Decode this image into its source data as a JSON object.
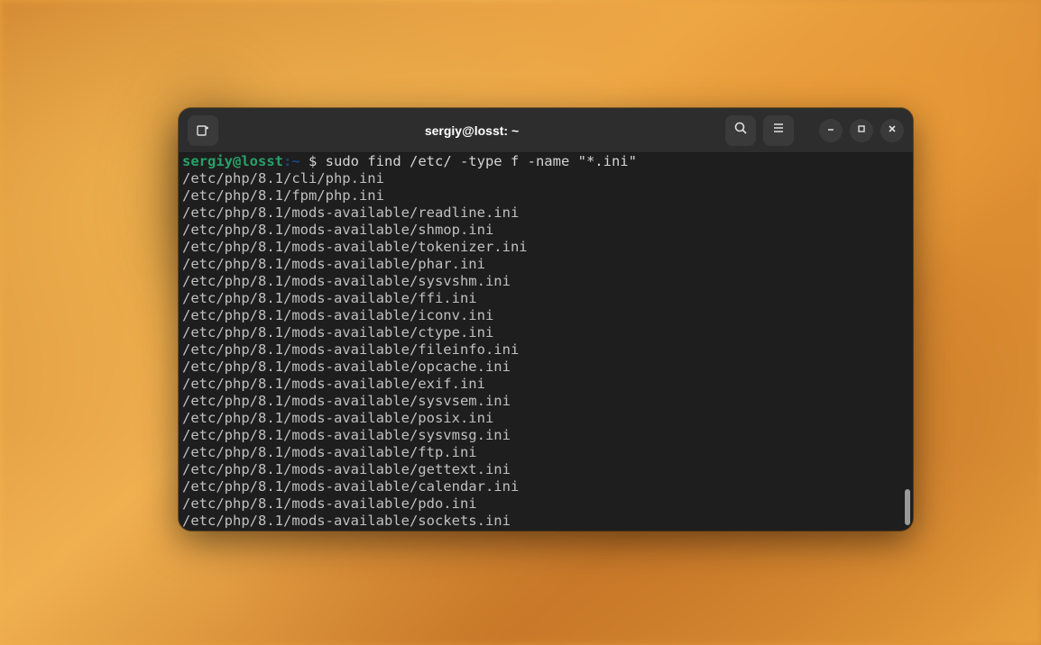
{
  "titlebar": {
    "title": "sergiy@losst: ~"
  },
  "terminal": {
    "prompt": {
      "user": "sergiy@losst",
      "colon": ":",
      "path": "~",
      "dollar": " $ "
    },
    "command": "sudo find /etc/ -type f -name \"*.ini\"",
    "output": [
      "/etc/php/8.1/cli/php.ini",
      "/etc/php/8.1/fpm/php.ini",
      "/etc/php/8.1/mods-available/readline.ini",
      "/etc/php/8.1/mods-available/shmop.ini",
      "/etc/php/8.1/mods-available/tokenizer.ini",
      "/etc/php/8.1/mods-available/phar.ini",
      "/etc/php/8.1/mods-available/sysvshm.ini",
      "/etc/php/8.1/mods-available/ffi.ini",
      "/etc/php/8.1/mods-available/iconv.ini",
      "/etc/php/8.1/mods-available/ctype.ini",
      "/etc/php/8.1/mods-available/fileinfo.ini",
      "/etc/php/8.1/mods-available/opcache.ini",
      "/etc/php/8.1/mods-available/exif.ini",
      "/etc/php/8.1/mods-available/sysvsem.ini",
      "/etc/php/8.1/mods-available/posix.ini",
      "/etc/php/8.1/mods-available/sysvmsg.ini",
      "/etc/php/8.1/mods-available/ftp.ini",
      "/etc/php/8.1/mods-available/gettext.ini",
      "/etc/php/8.1/mods-available/calendar.ini",
      "/etc/php/8.1/mods-available/pdo.ini",
      "/etc/php/8.1/mods-available/sockets.ini"
    ]
  }
}
